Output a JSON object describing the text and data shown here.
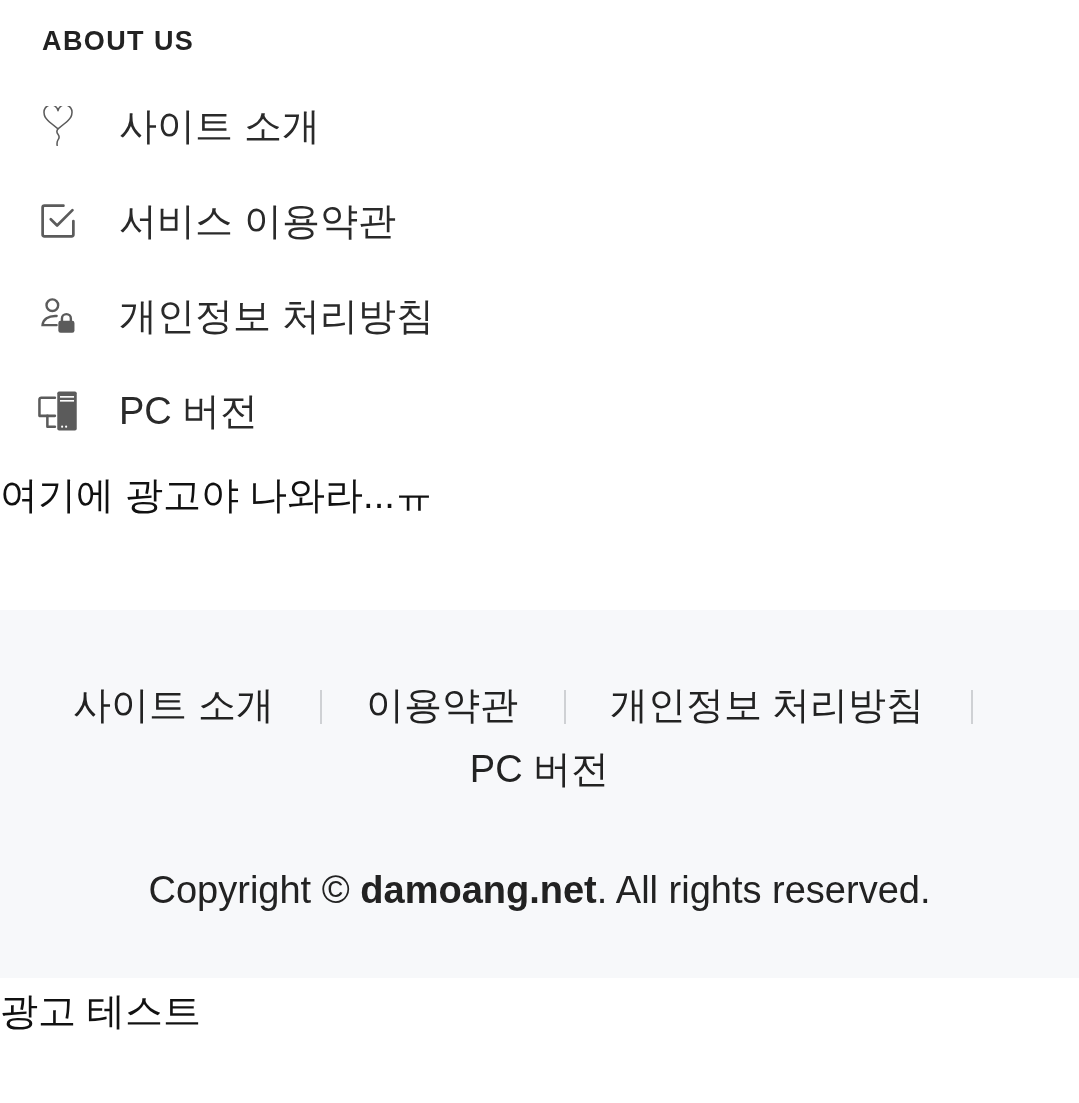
{
  "about_us": {
    "heading": "ABOUT US",
    "items": [
      {
        "kind": "balloon",
        "label": "사이트 소개"
      },
      {
        "kind": "checkbox",
        "label": "서비스 이용약관"
      },
      {
        "kind": "privacy",
        "label": "개인정보 처리방침"
      },
      {
        "kind": "pc",
        "label": "PC 버전"
      }
    ]
  },
  "ad_text": "여기에 광고야 나와라...ㅠ",
  "footer": {
    "links": [
      "사이트 소개",
      "이용약관",
      "개인정보 처리방침",
      "PC 버전"
    ],
    "copyright": "Copyright © **damoang.net**. All rights reserved."
  },
  "ad_test": "광고 테스트"
}
